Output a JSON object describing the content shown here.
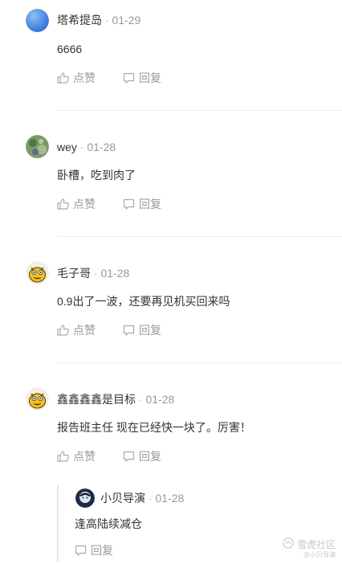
{
  "comments": [
    {
      "author": "塔希提岛",
      "sep": " · ",
      "date": "01-29",
      "text": "6666",
      "like_label": "点赞",
      "reply_label": "回复"
    },
    {
      "author": "wey",
      "sep": " · ",
      "date": "01-28",
      "text": "卧槽，吃到肉了",
      "like_label": "点赞",
      "reply_label": "回复"
    },
    {
      "author": "毛子哥",
      "sep": " · ",
      "date": "01-28",
      "text": "0.9出了一波，还要再见机买回来吗",
      "like_label": "点赞",
      "reply_label": "回复"
    },
    {
      "author": "鑫鑫鑫鑫是目标",
      "sep": " · ",
      "date": "01-28",
      "text": "报告班主任 现在已经快一块了。厉害！",
      "like_label": "点赞",
      "reply_label": "回复"
    }
  ],
  "reply": {
    "author": "小贝导演",
    "sep": " · ",
    "date": "01-28",
    "text": "逢高陆续减仓",
    "reply_label": "回复"
  },
  "watermark": {
    "main": "雪虎社区",
    "sub": "@小贝导演"
  },
  "icons": {
    "like": "thumbs-up-icon",
    "reply": "comment-bubble-icon"
  },
  "colors": {
    "text": "#333333",
    "muted": "#999999",
    "divider": "#eeeeee"
  }
}
